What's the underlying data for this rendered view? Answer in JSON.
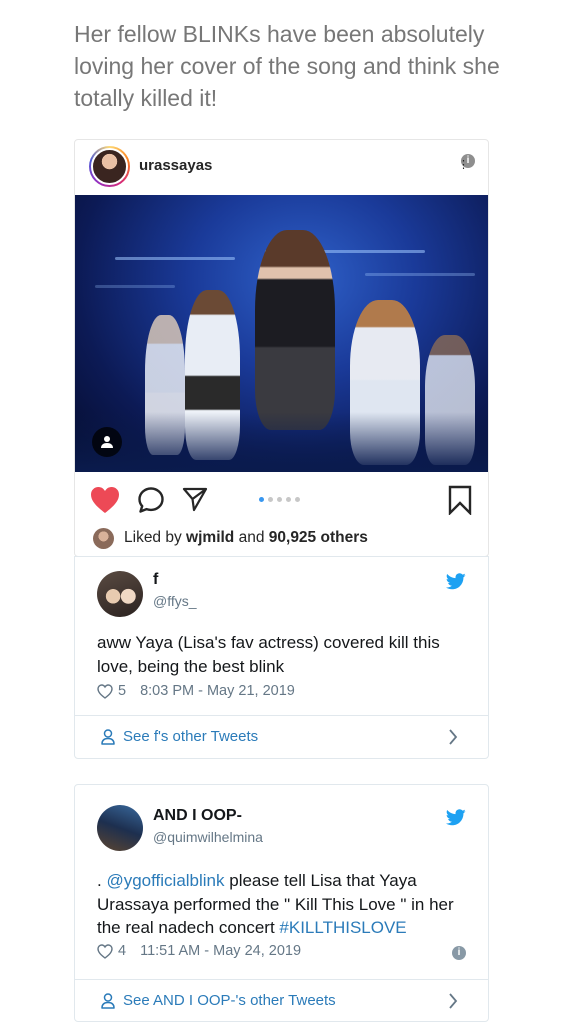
{
  "intro_text": "Her fellow BLINKs have been absolutely loving her cover of the song and think she totally killed it!",
  "instagram": {
    "username": "urassayas",
    "info_glyph": "i",
    "more_glyph": "⋮",
    "liked_by_prefix": "Liked by ",
    "liked_by_user": "wjmild",
    "liked_by_mid": " and ",
    "liked_by_count": "90,925 others",
    "carousel_total": 5,
    "carousel_active": 1,
    "icons": [
      "heart-icon",
      "comment-icon",
      "share-icon",
      "bookmark-icon",
      "user-tag-icon"
    ],
    "heart_color": "#ed4956"
  },
  "tweets": [
    {
      "name": "f",
      "handle": "@ffys_",
      "text": "aww Yaya (Lisa's fav actress) covered kill this love, being the best blink",
      "likes": "5",
      "timestamp": "8:03 PM - May 21, 2019",
      "see_more": "See f's other Tweets"
    },
    {
      "name": "AND I OOP-",
      "handle": "@quimwilhelmina",
      "text_prefix": ". ",
      "mention": "@ygofficialblink",
      "text_mid": " please tell Lisa that Yaya Urassaya performed the \" Kill This Love \" in her the real nadech concert ",
      "hashtag": "#KILLTHISLOVE",
      "likes": "4",
      "timestamp": "11:51 AM - May 24, 2019",
      "info_glyph": "i",
      "see_more": "See AND I OOP-'s other Tweets"
    }
  ],
  "colors": {
    "twitter_blue": "#1da1f2",
    "link_blue": "#2b7bb9",
    "muted_gray": "#657786"
  }
}
